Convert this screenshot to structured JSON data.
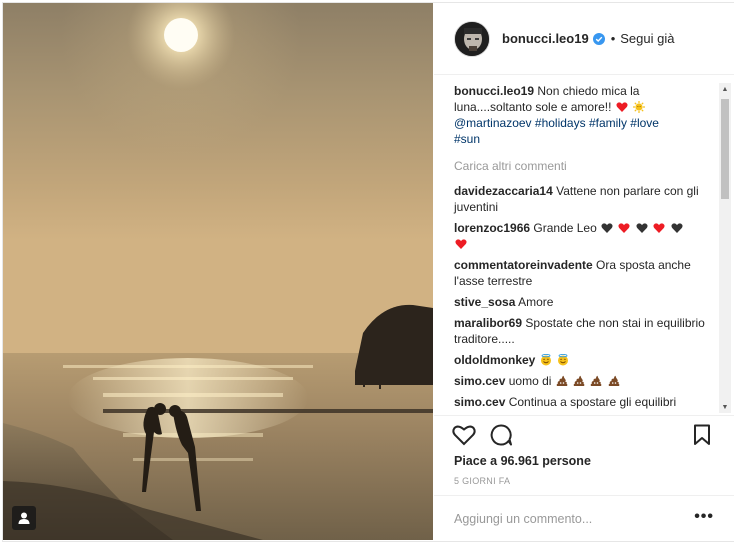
{
  "header": {
    "username": "bonucci.leo19",
    "separator": "•",
    "follow_label": "Segui già",
    "verified_icon": "verified-badge-icon"
  },
  "caption": {
    "username": "bonucci.leo19",
    "text": "Non chiedo mica la luna....soltanto sole e amore!!",
    "emoji": [
      "red-heart",
      "sun-face"
    ],
    "mention": "@martinazoev",
    "hashtags": [
      "#holidays",
      "#family",
      "#love",
      "#sun"
    ]
  },
  "load_more_label": "Carica altri commenti",
  "comments": [
    {
      "user": "davidezaccaria14",
      "text": "Vattene non parlare con gli juventini"
    },
    {
      "user": "lorenzoc1966",
      "text": "Grande Leo",
      "emoji": [
        "black-heart",
        "red-heart",
        "black-heart",
        "red-heart",
        "black-heart",
        "red-heart"
      ]
    },
    {
      "user": "commentatoreinvadente",
      "text": "Ora sposta anche l'asse terrestre"
    },
    {
      "user": "stive_sosa",
      "text": "Amore"
    },
    {
      "user": "maralibor69",
      "text": "Spostate che non stai in equilibrio traditore....."
    },
    {
      "user": "oldoldmonkey",
      "text": "",
      "emoji": [
        "smiling-face-halo",
        "smiling-face-halo"
      ]
    },
    {
      "user": "simo.cev",
      "text": "uomo di",
      "emoji": [
        "pile-of-poo",
        "pile-of-poo",
        "pile-of-poo",
        "pile-of-poo"
      ]
    },
    {
      "user": "simo.cev",
      "text": "Continua a spostare gli equilibri"
    }
  ],
  "likes_text": "Piace a 96.961 persone",
  "date_text": "5 GIORNI FA",
  "add_comment_placeholder": "Aggiungi un commento...",
  "more_options": "•••",
  "colors": {
    "hashtag": "#003569",
    "verified": "#3897f0",
    "muted": "#999999",
    "red_heart": "#ed1c24"
  }
}
